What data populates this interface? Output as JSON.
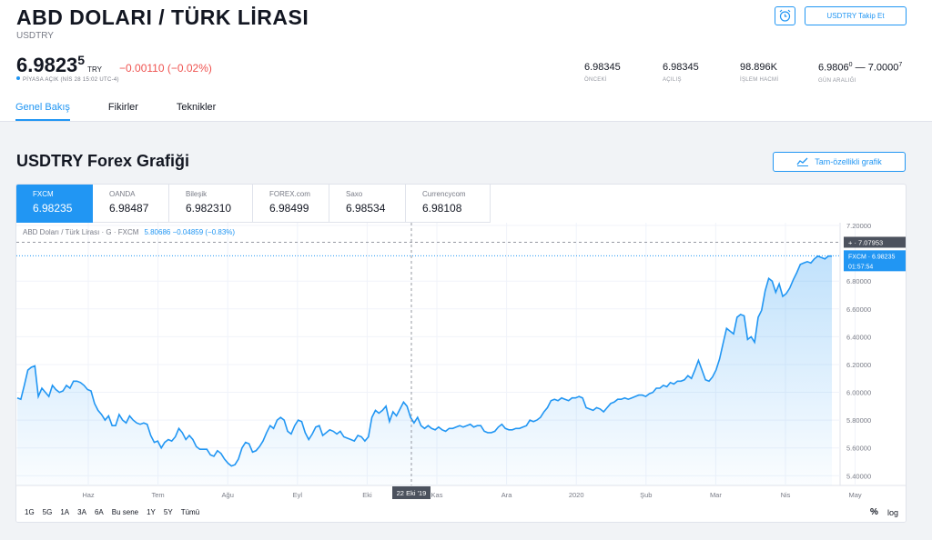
{
  "header": {
    "title": "ABD DOLARI / TÜRK LİRASI",
    "ticker": "USDTRY",
    "price_main": "6.9823",
    "price_sup": "5",
    "currency": "TRY",
    "change": "−0.00110 (−0.02%)",
    "market_status": "PİYASA AÇIK (NİS 28 15:02 UTC-4)",
    "follow_label": "USDTRY Takip Et"
  },
  "stats": [
    {
      "value": "6.98345",
      "label": "ÖNCEKİ"
    },
    {
      "value": "6.98345",
      "label": "AÇILIŞ"
    },
    {
      "value": "98.896K",
      "label": "İŞLEM HACMİ"
    },
    {
      "value_a": "6.9806",
      "sup_a": "0",
      "sep": " — ",
      "value_b": "7.0000",
      "sup_b": "7",
      "label": "GÜN ARALIĞI"
    }
  ],
  "tabs": [
    "Genel Bakış",
    "Fikirler",
    "Teknikler"
  ],
  "section": {
    "title": "USDTRY Forex Grafiği",
    "full_chart_label": "Tam-özellikli grafik"
  },
  "providers": [
    {
      "name": "FXCM",
      "price": "6.98235"
    },
    {
      "name": "OANDA",
      "price": "6.98487"
    },
    {
      "name": "Bileşik",
      "price": "6.982310"
    },
    {
      "name": "FOREX.com",
      "price": "6.98499"
    },
    {
      "name": "Saxo",
      "price": "6.98534"
    },
    {
      "name": "Currencycom",
      "price": "6.98108"
    }
  ],
  "legend": {
    "text": "ABD Doları / Türk Lirası · G · FXCM",
    "values": "5.80686 −0.04859 (−0.83%)"
  },
  "periods": [
    "1G",
    "5G",
    "1A",
    "3A",
    "6A",
    "Bu sene",
    "1Y",
    "5Y",
    "Tümü"
  ],
  "axis_controls": {
    "percent": "%",
    "log": "log"
  },
  "colors": {
    "accent": "#2196f3",
    "down": "#ef5350",
    "line": "#2196f3"
  },
  "chart_data": {
    "type": "area",
    "x_ticks": [
      "Haz",
      "Tem",
      "Ağu",
      "Eyl",
      "Eki",
      "Kas",
      "Ara",
      "2020",
      "Şub",
      "Mar",
      "Nis",
      "May"
    ],
    "y_ticks": [
      "7.20000",
      "6.80000",
      "6.60000",
      "6.40000",
      "6.20000",
      "6.00000",
      "5.80000",
      "5.60000",
      "5.40000"
    ],
    "ylim": [
      5.33,
      7.22
    ],
    "crosshair_x_label": "22 Eki '19",
    "crosshair_y_label": "7.07953",
    "crosshair_y_value": 7.07953,
    "last_label": "FXCM · 6.98235",
    "last_value": 6.98235,
    "countdown": "01:57:54",
    "series": [
      {
        "values": [
          5.96,
          5.95,
          6.05,
          6.16,
          6.18,
          6.19,
          5.97,
          6.03,
          6.0,
          5.97,
          6.05,
          6.02,
          6.0,
          6.01,
          6.05,
          6.03,
          6.08,
          6.08,
          6.07,
          6.05,
          6.02,
          6.01,
          5.92,
          5.87,
          5.84,
          5.8,
          5.83,
          5.76,
          5.76,
          5.84,
          5.8,
          5.78,
          5.83,
          5.8,
          5.78,
          5.77,
          5.78,
          5.77,
          5.69,
          5.64,
          5.65,
          5.6,
          5.64,
          5.66,
          5.65,
          5.68,
          5.74,
          5.71,
          5.66,
          5.69,
          5.66,
          5.61,
          5.59,
          5.59,
          5.59,
          5.55,
          5.54,
          5.58,
          5.56,
          5.52,
          5.49,
          5.47,
          5.48,
          5.52,
          5.6,
          5.64,
          5.63,
          5.57,
          5.58,
          5.61,
          5.65,
          5.71,
          5.76,
          5.74,
          5.8,
          5.82,
          5.8,
          5.72,
          5.7,
          5.76,
          5.8,
          5.79,
          5.71,
          5.66,
          5.7,
          5.75,
          5.76,
          5.69,
          5.71,
          5.73,
          5.72,
          5.7,
          5.72,
          5.68,
          5.67,
          5.66,
          5.65,
          5.69,
          5.68,
          5.65,
          5.68,
          5.82,
          5.87,
          5.85,
          5.87,
          5.9,
          5.79,
          5.86,
          5.83,
          5.88,
          5.93,
          5.9,
          5.82,
          5.78,
          5.82,
          5.76,
          5.74,
          5.76,
          5.74,
          5.73,
          5.75,
          5.73,
          5.72,
          5.74,
          5.74,
          5.75,
          5.76,
          5.75,
          5.76,
          5.77,
          5.75,
          5.76,
          5.76,
          5.72,
          5.71,
          5.71,
          5.72,
          5.75,
          5.77,
          5.74,
          5.73,
          5.73,
          5.74,
          5.74,
          5.75,
          5.76,
          5.8,
          5.79,
          5.8,
          5.82,
          5.86,
          5.89,
          5.94,
          5.95,
          5.94,
          5.96,
          5.95,
          5.94,
          5.96,
          5.96,
          5.97,
          5.96,
          5.89,
          5.88,
          5.87,
          5.89,
          5.88,
          5.86,
          5.89,
          5.92,
          5.93,
          5.95,
          5.95,
          5.96,
          5.95,
          5.96,
          5.97,
          5.98,
          5.98,
          5.97,
          5.99,
          6.0,
          6.03,
          6.03,
          6.05,
          6.04,
          6.07,
          6.06,
          6.08,
          6.08,
          6.09,
          6.12,
          6.1,
          6.16,
          6.23,
          6.16,
          6.09,
          6.08,
          6.11,
          6.16,
          6.24,
          6.35,
          6.46,
          6.44,
          6.42,
          6.54,
          6.56,
          6.55,
          6.38,
          6.4,
          6.36,
          6.54,
          6.59,
          6.73,
          6.82,
          6.8,
          6.72,
          6.78,
          6.69,
          6.71,
          6.75,
          6.81,
          6.86,
          6.92,
          6.93,
          6.94,
          6.93,
          6.96,
          6.98,
          6.97,
          6.96,
          6.98,
          6.98
        ]
      }
    ]
  }
}
